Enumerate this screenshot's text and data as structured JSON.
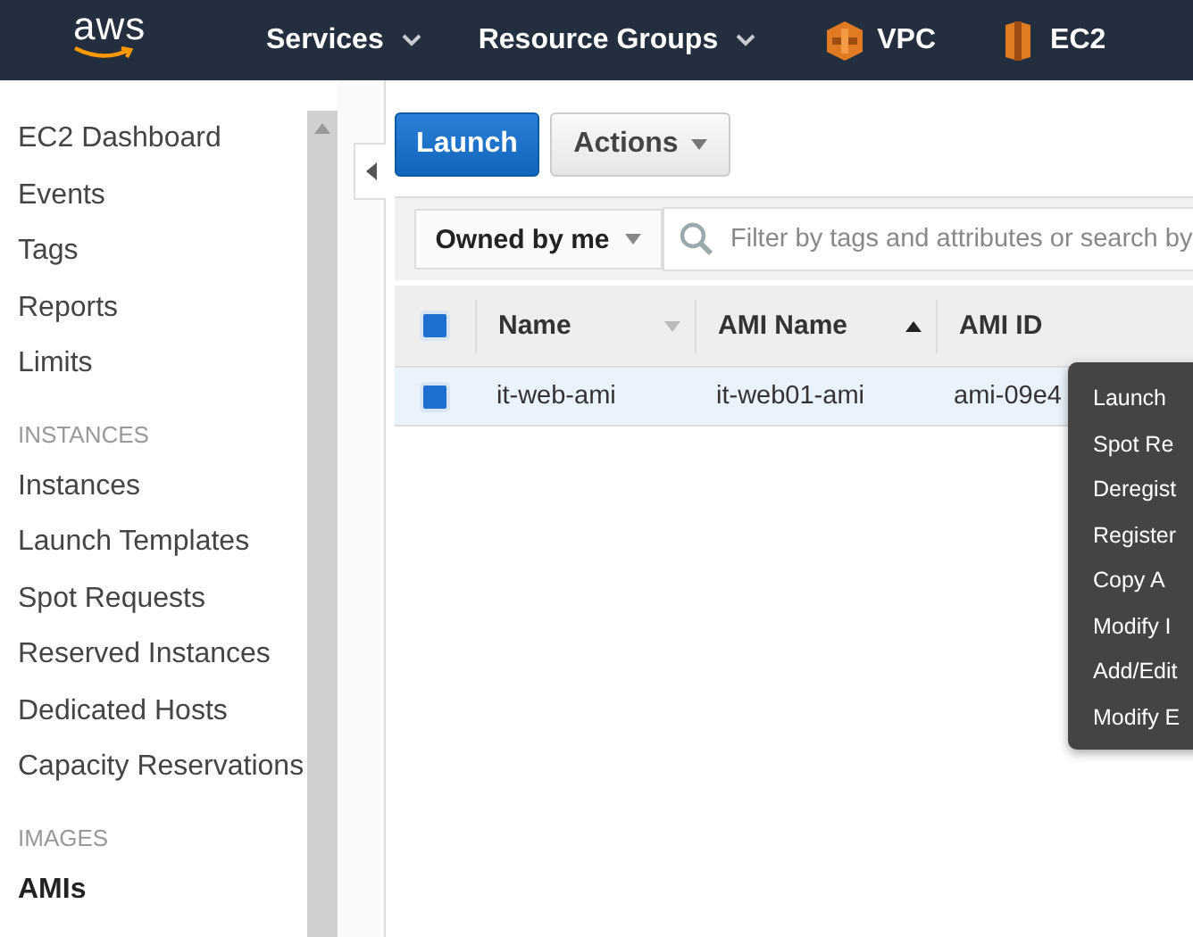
{
  "top_nav": {
    "logo": "aws",
    "menus": [
      {
        "label": "Services"
      },
      {
        "label": "Resource Groups"
      }
    ],
    "shortcuts": [
      {
        "label": "VPC",
        "kind": "vpc"
      },
      {
        "label": "EC2",
        "kind": "ec2"
      }
    ]
  },
  "sidebar": {
    "items": [
      {
        "kind": "item",
        "label": "EC2 Dashboard",
        "selected": false
      },
      {
        "kind": "item",
        "label": "Events",
        "selected": false
      },
      {
        "kind": "item",
        "label": "Tags",
        "selected": false
      },
      {
        "kind": "item",
        "label": "Reports",
        "selected": false
      },
      {
        "kind": "item",
        "label": "Limits",
        "selected": false
      },
      {
        "kind": "header",
        "label": "INSTANCES"
      },
      {
        "kind": "item",
        "label": "Instances",
        "selected": false
      },
      {
        "kind": "item",
        "label": "Launch Templates",
        "selected": false
      },
      {
        "kind": "item",
        "label": "Spot Requests",
        "selected": false
      },
      {
        "kind": "item",
        "label": "Reserved Instances",
        "selected": false
      },
      {
        "kind": "item",
        "label": "Dedicated Hosts",
        "selected": false
      },
      {
        "kind": "item",
        "label": "Capacity Reservations",
        "selected": false
      },
      {
        "kind": "header",
        "label": "IMAGES"
      },
      {
        "kind": "item",
        "label": "AMIs",
        "selected": true
      }
    ]
  },
  "toolbar": {
    "primary": "Launch",
    "actions": "Actions"
  },
  "filter": {
    "owner": "Owned by me",
    "placeholder": "Filter by tags and attributes or search by"
  },
  "table": {
    "all_checked": true,
    "columns": [
      {
        "label": "Name",
        "sorted": false
      },
      {
        "label": "AMI Name",
        "sorted": true
      },
      {
        "label": "AMI ID"
      }
    ],
    "rows": [
      {
        "checked": true,
        "selected": true,
        "cells": [
          "it-web-ami",
          "it-web01-ami",
          "ami-09e4"
        ]
      }
    ]
  },
  "context_menu": [
    "Launch",
    "Spot Re",
    "Deregist",
    "Register",
    "Copy A",
    "Modify I",
    "Add/Edit",
    "Modify E"
  ]
}
